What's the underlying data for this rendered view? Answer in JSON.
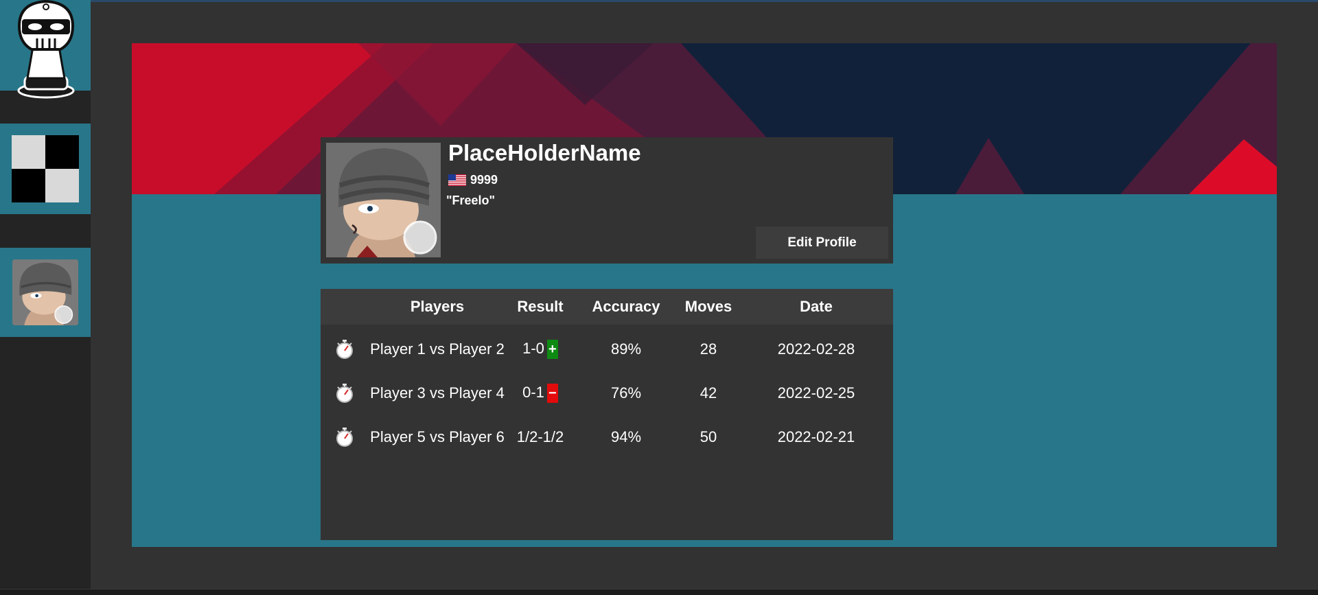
{
  "sidebar": {
    "logo_icon": "chess-pawn-mask-logo",
    "items": [
      {
        "name": "board",
        "icon": "checkerboard-icon"
      },
      {
        "name": "profile",
        "icon": "avatar-icon"
      }
    ]
  },
  "profile": {
    "name": "PlaceHolderName",
    "country_flag": "us-flag-icon",
    "rating": "9999",
    "motto": "\"Freelo\"",
    "edit_button": "Edit Profile"
  },
  "games": {
    "headers": [
      "",
      "Players",
      "Result",
      "Accuracy",
      "Moves",
      "Date"
    ],
    "rows": [
      {
        "icon": "stopwatch-icon",
        "players": "Player 1 vs Player 2",
        "result": "1-0",
        "outcome": "+",
        "accuracy": "89%",
        "moves": "28",
        "date": "2022-02-28"
      },
      {
        "icon": "stopwatch-icon",
        "players": "Player 3 vs Player 4",
        "result": "0-1",
        "outcome": "−",
        "accuracy": "76%",
        "moves": "42",
        "date": "2022-02-25"
      },
      {
        "icon": "stopwatch-icon",
        "players": "Player 5 vs Player 6",
        "result": "1/2-1/2",
        "outcome": "",
        "accuracy": "94%",
        "moves": "50",
        "date": "2022-02-21"
      }
    ]
  },
  "colors": {
    "accent_teal": "#287689",
    "banner_red": "#dc0c28",
    "banner_navy": "#12213a",
    "win_green": "#0e8a12",
    "loss_red": "#e30b0b",
    "card_bg": "#333333"
  }
}
